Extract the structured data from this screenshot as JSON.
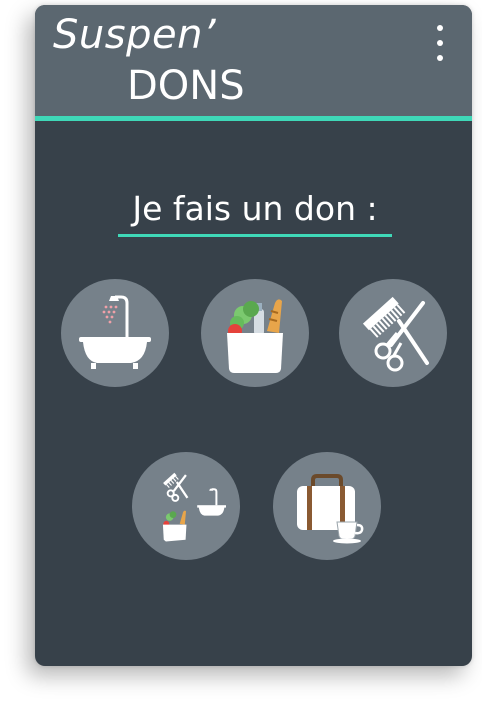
{
  "app": {
    "logo_line1": "Suspen’",
    "logo_line2": "DONS"
  },
  "page": {
    "title": "Je fais un don :"
  },
  "donation_options": [
    {
      "icon": "shower-bath-icon"
    },
    {
      "icon": "groceries-bag-icon"
    },
    {
      "icon": "comb-scissors-icon"
    },
    {
      "icon": "combo-pack-icon"
    },
    {
      "icon": "suitcase-coffee-icon"
    }
  ],
  "colors": {
    "header_bg": "#5b6770",
    "card_bg": "#37414a",
    "accent": "#3fd8b8",
    "button_bg": "#76818a"
  }
}
